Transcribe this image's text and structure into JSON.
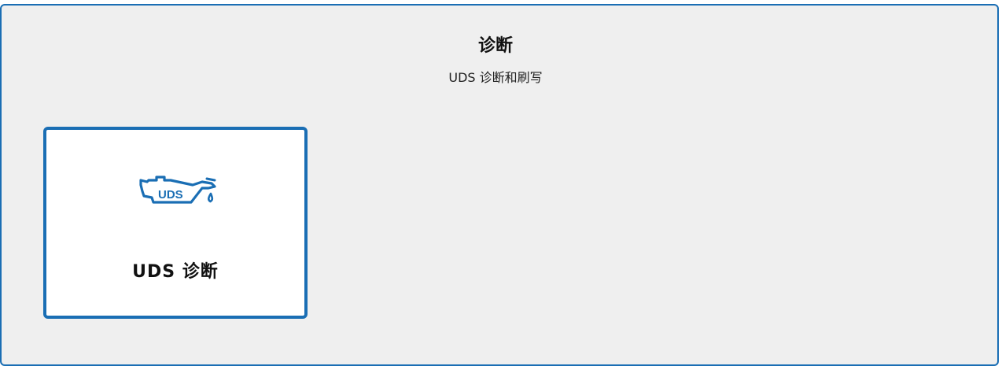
{
  "section": {
    "title": "诊断",
    "subtitle": "UDS 诊断和刷写"
  },
  "cards": [
    {
      "label": "UDS 诊断",
      "icon": "uds-oil-can-icon",
      "icon_text": "UDS"
    }
  ],
  "colors": {
    "accent": "#1a6eb4",
    "panel_bg": "#efefef",
    "card_bg": "#ffffff"
  }
}
